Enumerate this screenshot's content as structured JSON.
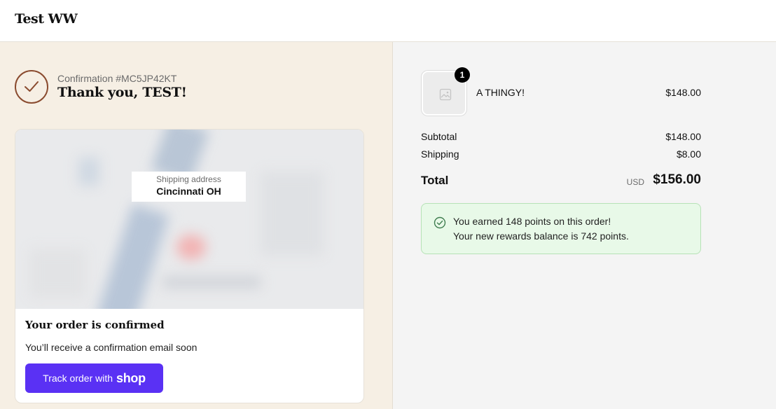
{
  "header": {
    "store_name": "Test WW"
  },
  "confirmation": {
    "number_label": "Confirmation #MC5JP42KT",
    "thanks": "Thank you, TEST!"
  },
  "map_card": {
    "address_label": "Shipping address",
    "address_value": "Cincinnati OH",
    "title": "Your order is confirmed",
    "subtitle": "You’ll receive a confirmation email soon",
    "track_button_text": "Track order with",
    "track_button_brand": "shop"
  },
  "summary": {
    "item": {
      "name": "A THINGY!",
      "price": "$148.00",
      "quantity": "1"
    },
    "subtotal_label": "Subtotal",
    "subtotal_value": "$148.00",
    "shipping_label": "Shipping",
    "shipping_value": "$8.00",
    "total_label": "Total",
    "total_currency": "USD",
    "total_value": "$156.00"
  },
  "rewards": {
    "line1": "You earned 148 points on this order!",
    "line2": "Your new rewards balance is 742 points."
  },
  "colors": {
    "accent": "#5a31f4",
    "left_bg": "#f6efe4",
    "right_bg": "#f4f4f4",
    "check": "#8a4b2f",
    "success_bg": "#e8f9e8"
  }
}
